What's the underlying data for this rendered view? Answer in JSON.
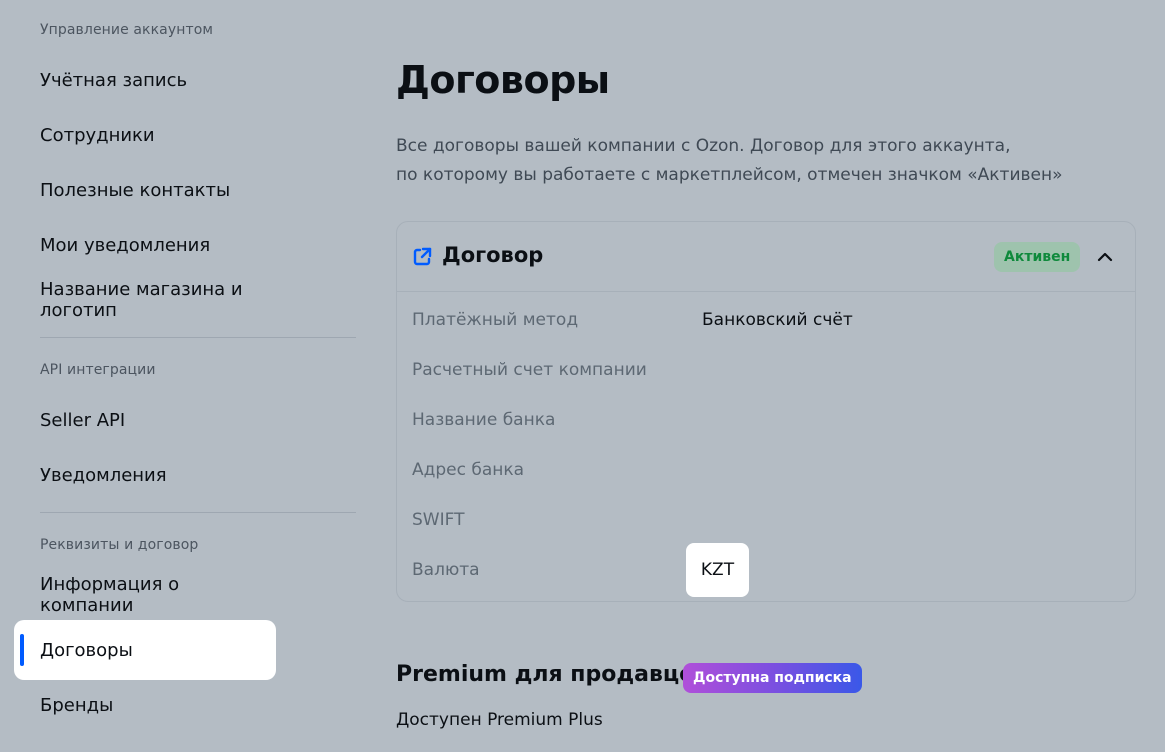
{
  "sidebar": {
    "sections": [
      {
        "title": "Управление аккаунтом",
        "items": [
          {
            "label": "Учётная запись"
          },
          {
            "label": "Сотрудники"
          },
          {
            "label": "Полезные контакты"
          },
          {
            "label": "Мои уведомления"
          },
          {
            "label": "Название магазина и логотип"
          }
        ]
      },
      {
        "title": "API интеграции",
        "items": [
          {
            "label": "Seller API"
          },
          {
            "label": "Уведомления"
          }
        ]
      },
      {
        "title": "Реквизиты и договор",
        "items": [
          {
            "label": "Информация о компании"
          },
          {
            "label": "Договоры",
            "active": true
          },
          {
            "label": "Бренды"
          }
        ]
      }
    ]
  },
  "main": {
    "title": "Договоры",
    "description_line1": "Все договоры вашей компании с Ozon. Договор для этого аккаунта,",
    "description_line2": "по которому вы работаете с маркетплейсом, отмечен значком «Активен»",
    "contract": {
      "icon": "external-link-icon",
      "title": "Договор",
      "status": "Активен",
      "status_color": "#0f8a3c",
      "collapse_icon": "chevron-up-icon",
      "rows": [
        {
          "label": "Платёжный метод",
          "value": "Банковский счёт"
        },
        {
          "label": "Расчетный счет компании",
          "value": ""
        },
        {
          "label": "Название банка",
          "value": ""
        },
        {
          "label": "Адрес банка",
          "value": ""
        },
        {
          "label": "SWIFT",
          "value": ""
        },
        {
          "label": "Валюта",
          "value": "KZT"
        }
      ]
    },
    "premium": {
      "title": "Premium для продавцов",
      "badge": "Доступна подписка",
      "subtitle": "Доступен Premium Plus"
    }
  },
  "colors": {
    "background": "#b4bcc4",
    "accent": "#005bff"
  }
}
